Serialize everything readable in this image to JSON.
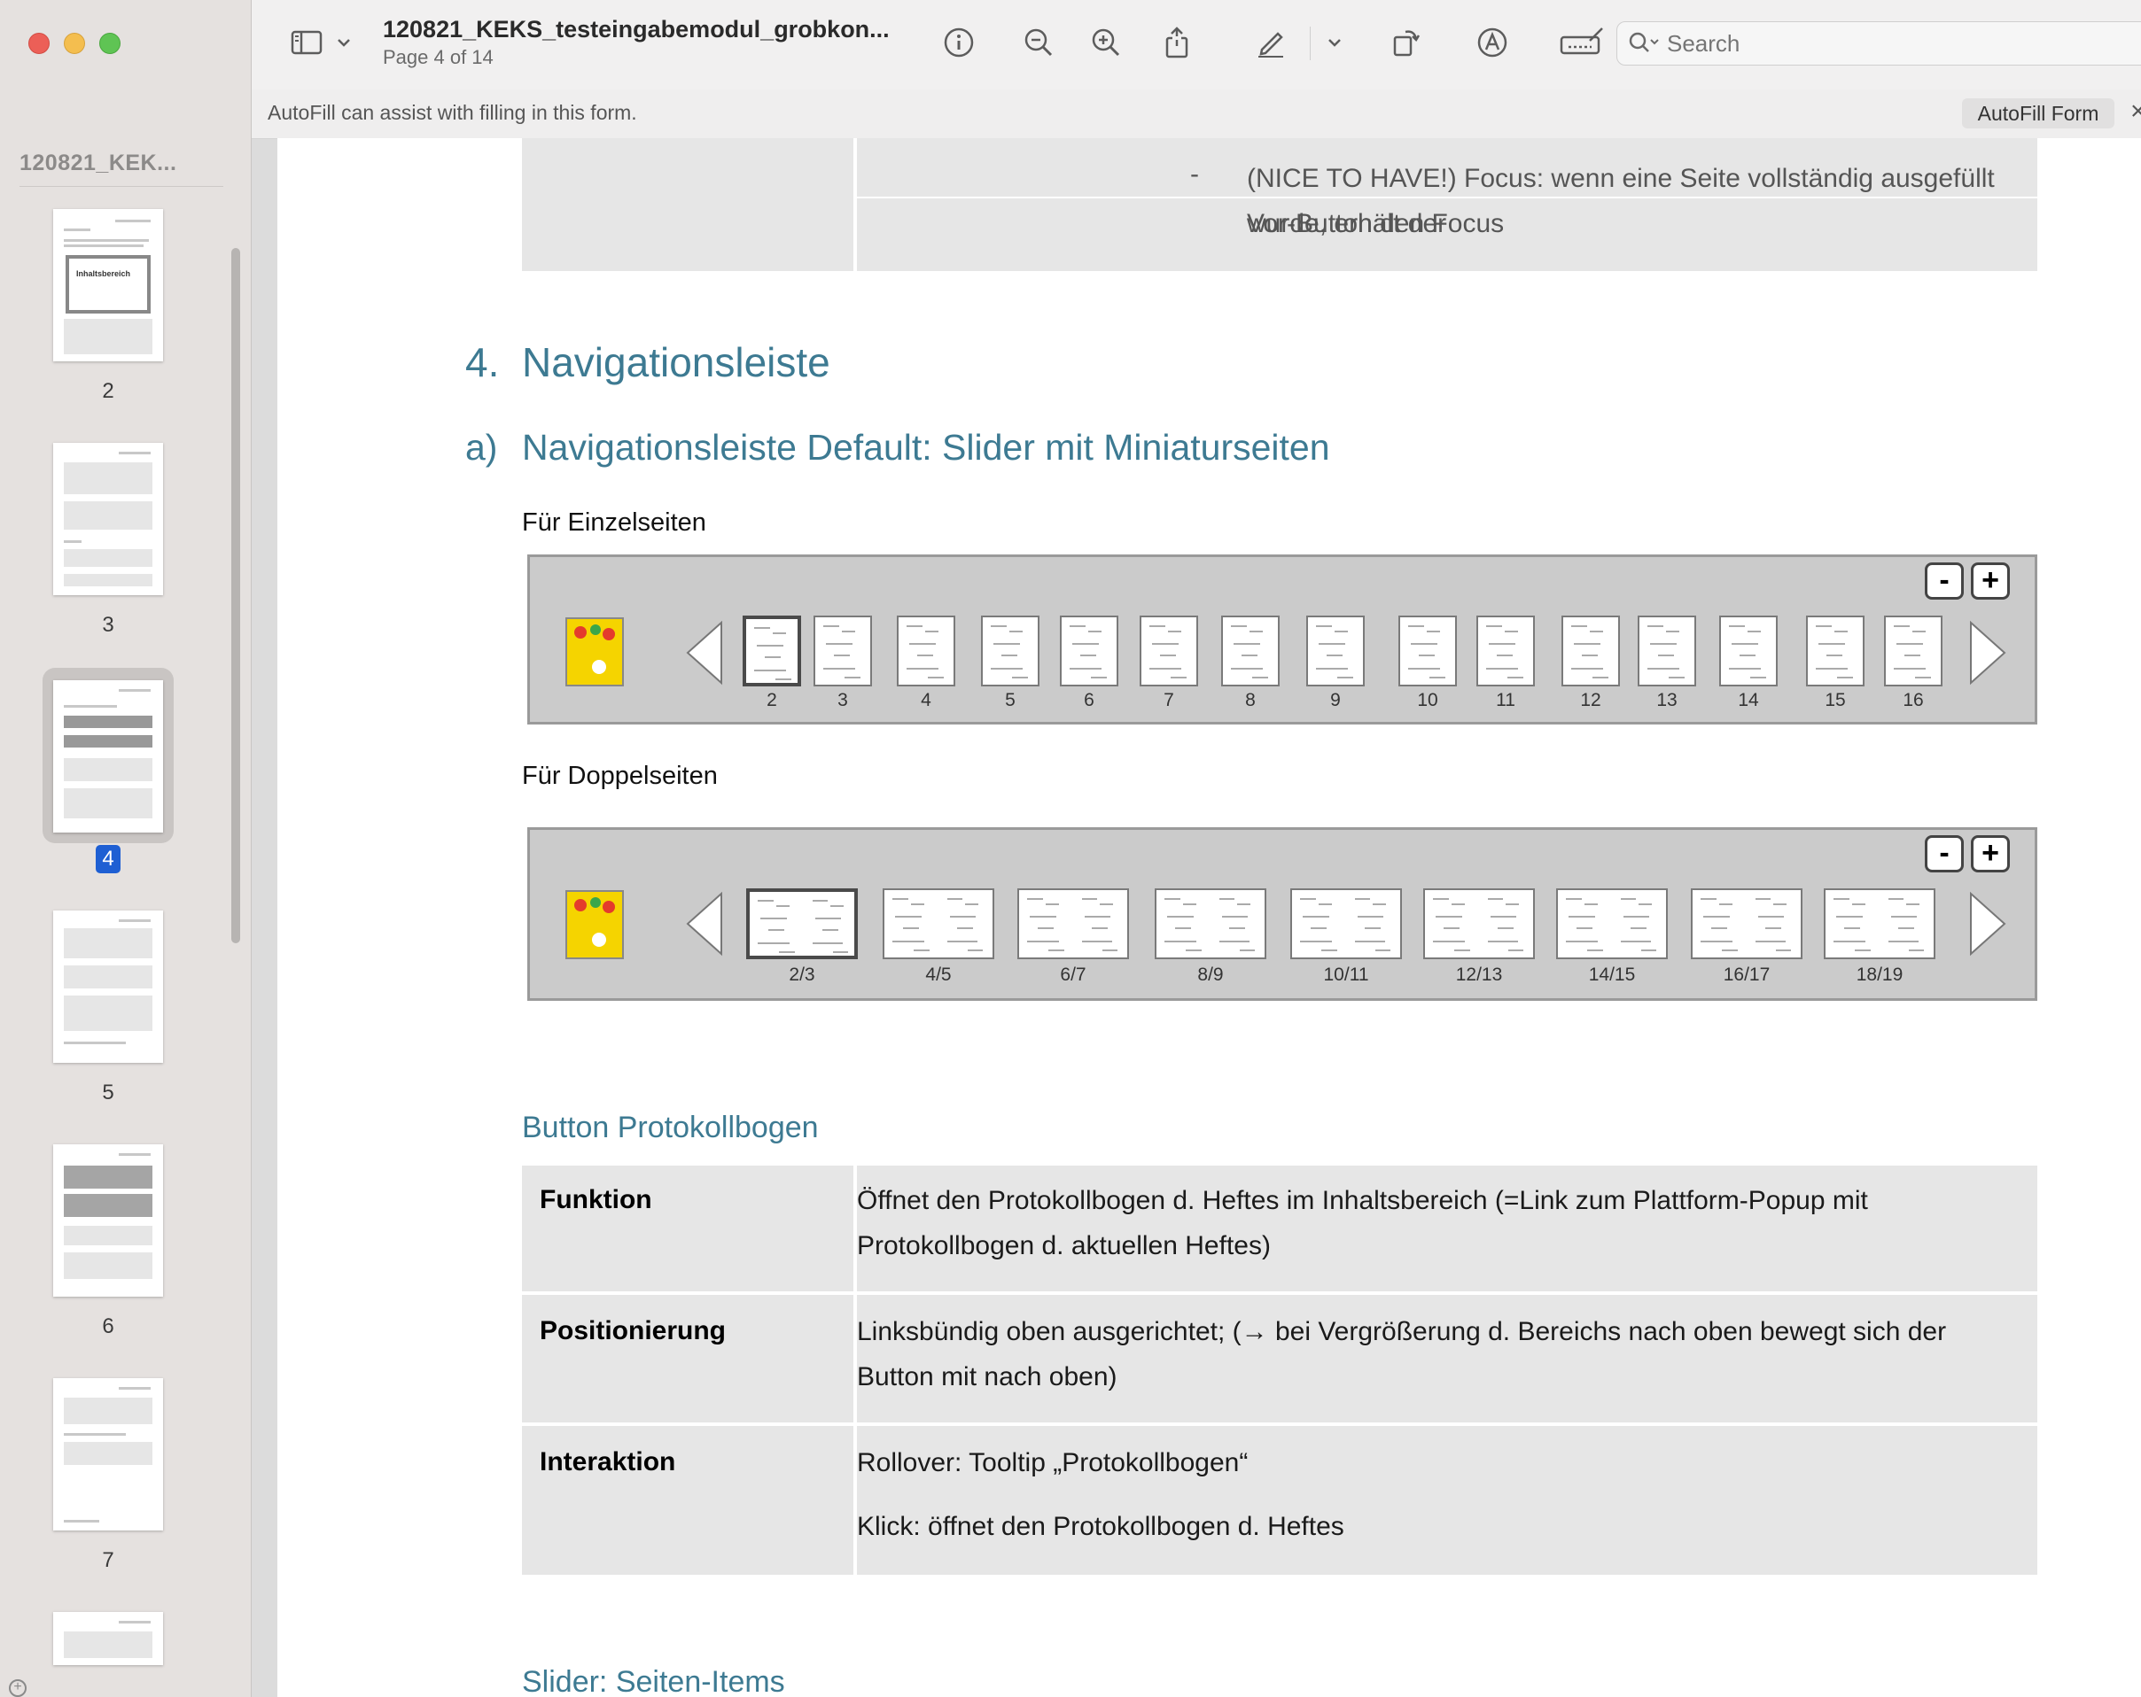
{
  "sidebar": {
    "title": "120821_KEK...",
    "thumbnails": [
      {
        "page": "2"
      },
      {
        "page": "3"
      },
      {
        "page": "4"
      },
      {
        "page": "5"
      },
      {
        "page": "6"
      },
      {
        "page": "7"
      }
    ],
    "thumb_text": "Inhaltsbereich"
  },
  "toolbar": {
    "doc_title": "120821_KEKS_testeingabemodul_grobkon...",
    "page_info": "Page 4 of 14",
    "search_placeholder": "Search",
    "icons": [
      "sidebar-toggle-icon",
      "chevron-down-icon",
      "info-icon",
      "zoom-out-icon",
      "zoom-in-icon",
      "share-icon",
      "markup-pen-icon",
      "chevron-down-icon",
      "rotate-icon",
      "annotate-icon",
      "form-fill-icon",
      "search-icon"
    ]
  },
  "autofill": {
    "message": "AutoFill can assist with filling in this form.",
    "button": "AutoFill Form",
    "close": "×"
  },
  "document": {
    "top_bullet_dash": "-",
    "top_bullet_line1": "(NICE TO HAVE!) Focus: wenn eine Seite vollständig ausgefüllt wurde, erhält der",
    "top_bullet_line2": "Vor-Button den Focus",
    "h1_number": "4.",
    "h1_text": "Navigationsleiste",
    "h2_number": "a)",
    "h2_text": "Navigationsleiste Default: Slider mit Miniaturseiten",
    "caption_single": "Für Einzelseiten",
    "caption_double": "Für Doppelseiten",
    "single_pages": [
      "2",
      "3",
      "4",
      "5",
      "6",
      "7",
      "8",
      "9",
      "10",
      "11",
      "12",
      "13",
      "14",
      "15",
      "16"
    ],
    "double_pages": [
      "2/3",
      "4/5",
      "6/7",
      "8/9",
      "10/11",
      "12/13",
      "14/15",
      "16/17",
      "18/19"
    ],
    "zoom_minus": "-",
    "zoom_plus": "+",
    "section_button": "Button Protokollbogen",
    "table": [
      {
        "label": "Funktion",
        "lines": [
          "Öffnet den Protokollbogen d. Heftes im Inhaltsbereich (=Link zum Plattform-Popup mit",
          "Protokollbogen d. aktuellen Heftes)"
        ]
      },
      {
        "label": "Positionierung",
        "lines": [
          "Linksbündig oben ausgerichtet; (→ bei Vergrößerung d. Bereichs nach oben bewegt sich der",
          "Button mit nach oben)"
        ]
      },
      {
        "label": "Interaktion",
        "lines": [
          "Rollover: Tooltip „Protokollbogen“",
          "Klick: öffnet den Protokollbogen d. Heftes"
        ]
      }
    ],
    "section_slider": "Slider: Seiten-Items"
  },
  "colors": {
    "heading": "#3d7a92",
    "selection_badge": "#1e5fd3",
    "cover": "#f5d400"
  }
}
